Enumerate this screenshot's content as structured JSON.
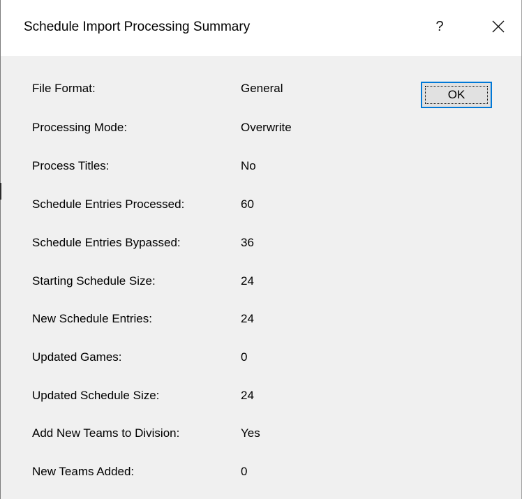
{
  "dialog": {
    "title": "Schedule Import Processing Summary",
    "help_label": "?",
    "close_icon": "close-icon",
    "ok_label": "OK"
  },
  "summary": [
    {
      "label": "File Format:",
      "value": "General"
    },
    {
      "label": "Processing Mode:",
      "value": "Overwrite"
    },
    {
      "label": "Process Titles:",
      "value": "No"
    },
    {
      "label": "Schedule Entries Processed:",
      "value": "60"
    },
    {
      "label": "Schedule Entries Bypassed:",
      "value": "36"
    },
    {
      "label": "Starting Schedule Size:",
      "value": "24"
    },
    {
      "label": "New Schedule Entries:",
      "value": "24"
    },
    {
      "label": "Updated Games:",
      "value": "0"
    },
    {
      "label": "Updated Schedule Size:",
      "value": "24"
    },
    {
      "label": "Add New Teams to Division:",
      "value": "Yes"
    },
    {
      "label": "New Teams Added:",
      "value": "0"
    }
  ],
  "colors": {
    "accent": "#0078d7",
    "dialog_bg": "#f0f0f0",
    "titlebar_bg": "#ffffff"
  }
}
